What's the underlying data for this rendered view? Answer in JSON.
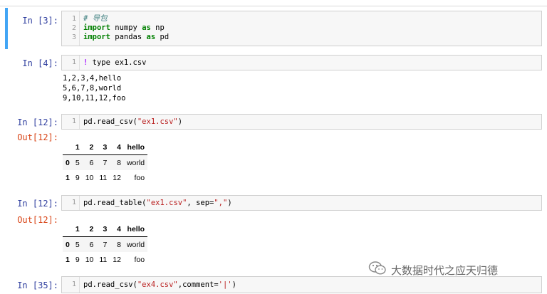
{
  "cells": [
    {
      "prompt": "In  [3]:",
      "lines": [
        "1",
        "2",
        "3"
      ]
    },
    {
      "prompt": "In  [4]:",
      "lines": [
        "1"
      ],
      "output": [
        "1,2,3,4,hello",
        "5,6,7,8,world",
        "9,10,11,12,foo"
      ]
    },
    {
      "prompt": "In  [12]:",
      "out_prompt": "Out[12]:",
      "lines": [
        "1"
      ]
    },
    {
      "prompt": "In  [12]:",
      "out_prompt": "Out[12]:",
      "lines": [
        "1"
      ]
    },
    {
      "prompt": "In  [35]:",
      "lines": [
        "1"
      ]
    }
  ],
  "code": {
    "c1_l1_comment": "# 导包",
    "c1_l2_kw": "import",
    "c1_l2_mod": " numpy ",
    "c1_l2_as": "as",
    "c1_l2_alias": " np",
    "c1_l3_kw": "import",
    "c1_l3_mod": " pandas ",
    "c1_l3_as": "as",
    "c1_l3_alias": " pd",
    "c2_bang": "!",
    "c2_cmd": " type ex1.csv",
    "c3_pre": "pd.read_csv(",
    "c3_str": "\"ex1.csv\"",
    "c3_post": ")",
    "c4_pre": "pd.read_table(",
    "c4_str1": "\"ex1.csv\"",
    "c4_mid": ", sep=",
    "c4_str2": "\",\"",
    "c4_post": ")",
    "c5_pre": "pd.read_csv(",
    "c5_str1": "\"ex4.csv\"",
    "c5_mid": ",comment=",
    "c5_str2": "'|'",
    "c5_post": ")"
  },
  "dataframe": {
    "columns": [
      "1",
      "2",
      "3",
      "4",
      "hello"
    ],
    "rows": [
      {
        "index": "0",
        "values": [
          "5",
          "6",
          "7",
          "8",
          "world"
        ]
      },
      {
        "index": "1",
        "values": [
          "9",
          "10",
          "11",
          "12",
          "foo"
        ]
      }
    ]
  },
  "watermark": {
    "text": "大数据时代之应天归德",
    "icon": "wechat-icon"
  }
}
